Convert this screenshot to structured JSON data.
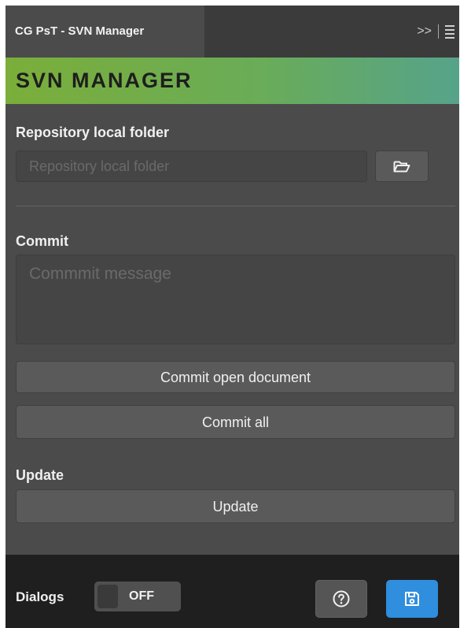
{
  "tabbar": {
    "tab_label": "CG PsT - SVN Manager",
    "expand_glyph": ">>",
    "menu_icon": "hamburger-menu-icon"
  },
  "banner": {
    "title": "SVN MANAGER"
  },
  "repository": {
    "label": "Repository local folder",
    "placeholder": "Repository local folder",
    "value": "",
    "browse_icon": "folder-open-icon"
  },
  "commit": {
    "label": "Commit",
    "placeholder": "Commmit message",
    "value": "",
    "open_document_label": "Commit open document",
    "all_label": "Commit all"
  },
  "update": {
    "label": "Update",
    "button_label": "Update"
  },
  "footer": {
    "dialogs_label": "Dialogs",
    "toggle_state": "OFF",
    "help_icon": "help-circle-icon",
    "save_icon": "save-icon"
  },
  "colors": {
    "panel_bg": "#4b4b4b",
    "tab_strip_bg": "#3b3b3b",
    "banner_gradient": [
      "#7bae3a",
      "#56a38a"
    ],
    "footer_bg": "#1f1f1f",
    "accent_blue": "#2f8edd"
  }
}
